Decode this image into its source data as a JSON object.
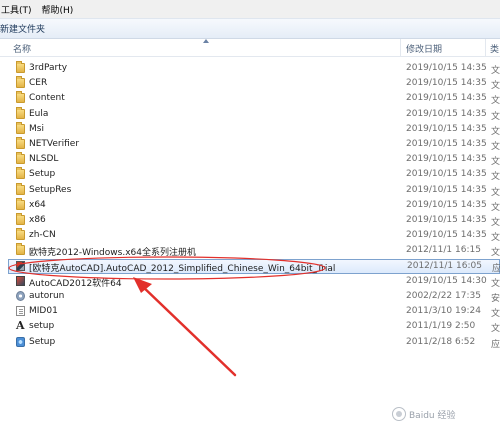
{
  "menubar": {
    "items": [
      "工具(T)",
      "帮助(H)"
    ]
  },
  "toolbar": {
    "new_folder_label": "新建文件夹"
  },
  "header": {
    "name": "名称",
    "date": "修改日期",
    "type": "类"
  },
  "files": [
    {
      "name": "3rdParty",
      "date": "2019/10/15 14:35",
      "type": "文",
      "icon": "folder-icon"
    },
    {
      "name": "CER",
      "date": "2019/10/15 14:35",
      "type": "文",
      "icon": "folder-icon"
    },
    {
      "name": "Content",
      "date": "2019/10/15 14:35",
      "type": "文",
      "icon": "folder-icon"
    },
    {
      "name": "Eula",
      "date": "2019/10/15 14:35",
      "type": "文",
      "icon": "folder-icon"
    },
    {
      "name": "Msi",
      "date": "2019/10/15 14:35",
      "type": "文",
      "icon": "folder-icon"
    },
    {
      "name": "NETVerifier",
      "date": "2019/10/15 14:35",
      "type": "文",
      "icon": "folder-icon"
    },
    {
      "name": "NLSDL",
      "date": "2019/10/15 14:35",
      "type": "文",
      "icon": "folder-icon"
    },
    {
      "name": "Setup",
      "date": "2019/10/15 14:35",
      "type": "文",
      "icon": "folder-icon"
    },
    {
      "name": "SetupRes",
      "date": "2019/10/15 14:35",
      "type": "文",
      "icon": "folder-icon"
    },
    {
      "name": "x64",
      "date": "2019/10/15 14:35",
      "type": "文",
      "icon": "folder-icon"
    },
    {
      "name": "x86",
      "date": "2019/10/15 14:35",
      "type": "文",
      "icon": "folder-icon"
    },
    {
      "name": "zh-CN",
      "date": "2019/10/15 14:35",
      "type": "文",
      "icon": "folder-icon"
    },
    {
      "name": "欧特克2012-Windows.x64全系列注册机",
      "date": "2012/11/1 16:15",
      "type": "文",
      "icon": "folder-icon"
    },
    {
      "name": "[欧特克AutoCAD].AutoCAD_2012_Simplified_Chinese_Win_64bit_Trial",
      "date": "2012/11/1 16:05",
      "type": "应",
      "icon": "app-icon",
      "selected": true
    },
    {
      "name": "AutoCAD2012软件64",
      "date": "2019/10/15 14:30",
      "type": "文",
      "icon": "app2-icon"
    },
    {
      "name": "autorun",
      "date": "2002/2/22 17:35",
      "type": "安",
      "icon": "gear-icon"
    },
    {
      "name": "MID01",
      "date": "2011/3/10 19:24",
      "type": "文",
      "icon": "doc-icon"
    },
    {
      "name": "setup",
      "date": "2011/1/19 2:50",
      "type": "文",
      "icon": "font-icon",
      "glyph": "A"
    },
    {
      "name": "Setup",
      "date": "2011/2/18 6:52",
      "type": "应",
      "icon": "setup-icon"
    }
  ],
  "colors": {
    "selection_border": "#7da2ce",
    "annotation_red": "#e2302b"
  },
  "watermark": {
    "text": "Baidu 经验"
  }
}
